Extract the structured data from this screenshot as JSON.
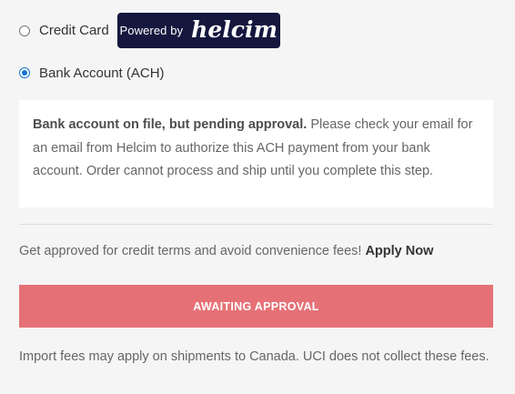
{
  "payment": {
    "credit_card": {
      "label": "Credit Card",
      "selected": false,
      "badge_prefix": "Powered by",
      "badge_brand": "helcim",
      "badge_bg_color": "#15173e"
    },
    "bank_account": {
      "label": "Bank Account (ACH)",
      "selected": true
    },
    "radio_accent_color": "#0f73d1"
  },
  "notice": {
    "bold": "Bank account on file, but pending approval.",
    "text": " Please check your email for an email from Helcim to authorize this ACH payment from your bank account. Order cannot process and ship until you complete this step."
  },
  "terms": {
    "text": "Get approved for credit terms and avoid convenience fees! ",
    "link": "Apply Now"
  },
  "action": {
    "label": "AWAITING APPROVAL",
    "color": "#e57176"
  },
  "footnote": "Import fees may apply on shipments to Canada. UCI does not collect these fees."
}
